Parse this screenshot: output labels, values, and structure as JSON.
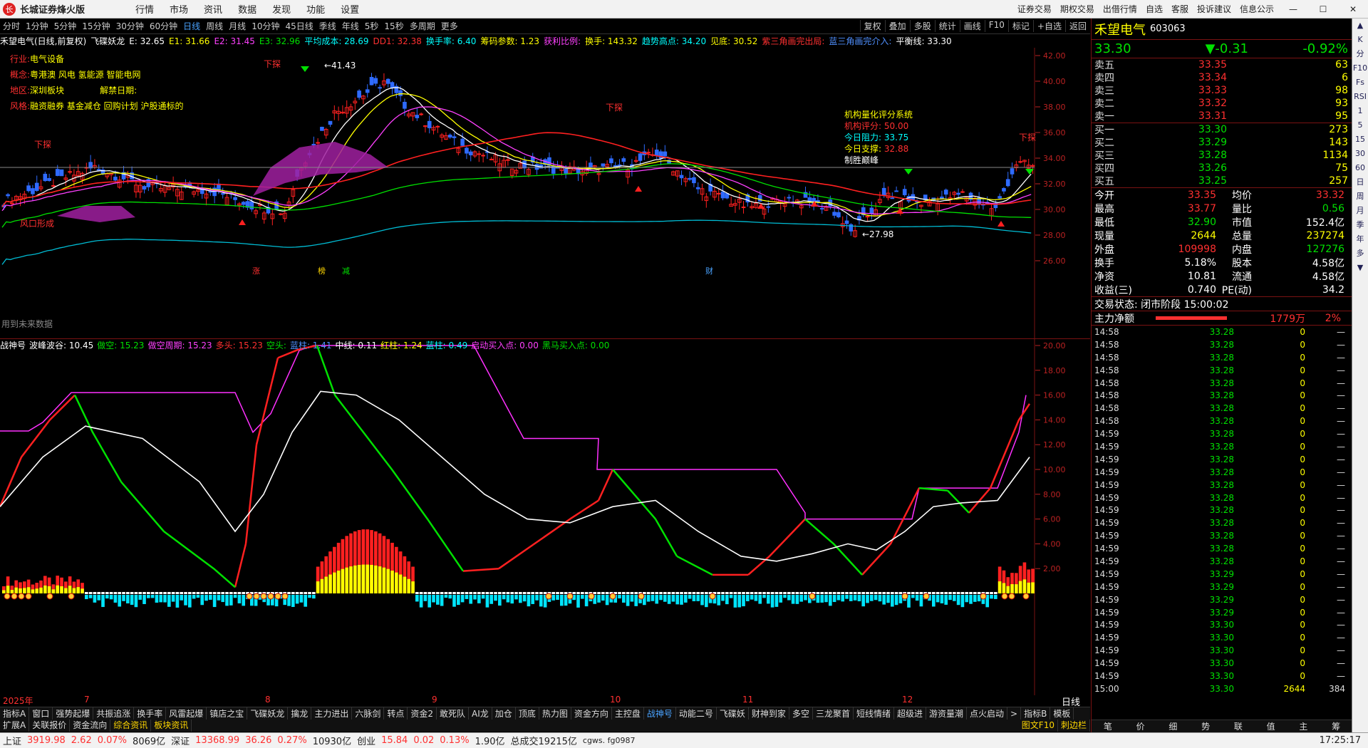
{
  "titlebar": {
    "app_title": "长城证券烽火版",
    "menu": [
      "行情",
      "市场",
      "资讯",
      "数据",
      "发现",
      "功能",
      "设置"
    ],
    "right": [
      "证券交易",
      "期权交易",
      "出借行情",
      "自选",
      "客服",
      "投诉建议",
      "信息公示"
    ]
  },
  "periods": [
    "分时",
    "1分钟",
    "5分钟",
    "15分钟",
    "30分钟",
    "60分钟",
    "日线",
    "周线",
    "月线",
    "10分钟",
    "45日线",
    "季线",
    "年线",
    "5秒",
    "15秒",
    "多周期",
    "更多"
  ],
  "active_period": "日线",
  "right_buttons": [
    "复权",
    "叠加",
    "多股",
    "统计",
    "画线",
    "F10",
    "标记",
    "+自选",
    "返回"
  ],
  "info": [
    {
      "t": "禾望电气(日线,前复权)",
      "c": "white"
    },
    {
      "t": "飞碟妖龙",
      "c": "white"
    },
    {
      "t": "E: 32.65",
      "c": "white"
    },
    {
      "t": "E1: 31.66",
      "c": "yellow"
    },
    {
      "t": "E2: 31.45",
      "c": "magenta"
    },
    {
      "t": "E3: 32.96",
      "c": "green"
    },
    {
      "t": "平均成本: 28.69",
      "c": "cyan"
    },
    {
      "t": "DD1: 32.38",
      "c": "red"
    },
    {
      "t": "换手率: 6.40",
      "c": "cyan"
    },
    {
      "t": "筹码参数: 1.23",
      "c": "yellow"
    },
    {
      "t": "获利比例:",
      "c": "magenta"
    },
    {
      "t": "换手: 143.32",
      "c": "yellow"
    },
    {
      "t": "趋势高点: 34.20",
      "c": "cyan"
    },
    {
      "t": "见底: 30.52",
      "c": "yellow"
    },
    {
      "t": "紫三角画完出局:",
      "c": "red"
    },
    {
      "t": "蓝三角画完介入:",
      "c": "blue"
    },
    {
      "t": "平衡线: 33.30",
      "c": "white"
    }
  ],
  "stock_info": {
    "industry": "行业:",
    "industry_val": "电气设备",
    "concept": "概念:",
    "concept_val": "粤港澳 风电 氢能源 智能电网",
    "region": "地区:",
    "region_val": "深圳板块",
    "unlock": "解禁日期:",
    "style": "风格:",
    "style_val": "融资融券 基金减仓 回购计划 沪股通标的"
  },
  "rating": {
    "title": "机构量化评分系统",
    "score_label": "机构评分:",
    "score": "50.00",
    "resist_label": "今日阻力:",
    "resist": "33.75",
    "support_label": "今日支撑:",
    "support": "32.88",
    "tag": "制胜巅峰"
  },
  "chart_labels": {
    "future": "用到未来数据",
    "xiatan": "下探",
    "fengkou": "风口形成",
    "high": "41.43",
    "low": "27.98",
    "zhangting": "涨",
    "bang": "榜",
    "jian": "减",
    "cai": "财"
  },
  "y_ticks_main": [
    "42.00",
    "40.00",
    "38.00",
    "36.00",
    "34.00",
    "32.00",
    "30.00",
    "28.00",
    "26.00"
  ],
  "sub_info": [
    {
      "t": "战神号",
      "c": "white"
    },
    {
      "t": "波峰波谷: 10.45",
      "c": "white"
    },
    {
      "t": "做空: 15.23",
      "c": "green"
    },
    {
      "t": "做空周期: 15.23",
      "c": "magenta"
    },
    {
      "t": "多头: 15.23",
      "c": "red"
    },
    {
      "t": "空头:",
      "c": "green"
    },
    {
      "t": "蓝柱: 1.41",
      "c": "blue"
    },
    {
      "t": "中线: 0.11",
      "c": "white"
    },
    {
      "t": "红柱: 1.24",
      "c": "yellow"
    },
    {
      "t": "蓝柱: 0.49",
      "c": "cyan"
    },
    {
      "t": "启动买入点: 0.00",
      "c": "magenta"
    },
    {
      "t": "黑马买入点: 0.00",
      "c": "green"
    }
  ],
  "y_ticks_sub": [
    "20.00",
    "18.00",
    "16.00",
    "14.00",
    "12.00",
    "10.00",
    "8.00",
    "6.00",
    "4.00",
    "2.00"
  ],
  "dates": [
    "2025年",
    "7",
    "8",
    "9",
    "10",
    "11",
    "12"
  ],
  "tabs1": [
    "指标A",
    "窗口",
    "强势起爆",
    "共振追涨",
    "换手率",
    "风雷起爆",
    "镇店之宝",
    "飞碟妖龙",
    "擒龙",
    "主力进出",
    "六脉剑",
    "转点",
    "资金2",
    "敢死队",
    "AI龙",
    "加仓",
    "顶底",
    "热力图",
    "资金方向",
    "主控盘",
    "战神号",
    "动能二号",
    "飞碟妖",
    "财神到家",
    "多空",
    "三龙聚首",
    "短线情绪",
    "超级进",
    "游资量潮",
    "点火启动",
    ">",
    "指标B",
    "模板"
  ],
  "tabs1_active": "战神号",
  "tabs2": [
    "扩展A",
    "关联报价",
    "资金流向",
    "综合资讯",
    "板块资讯"
  ],
  "tabs2_right": [
    "图文F10",
    "刺边栏"
  ],
  "status": {
    "sh_label": "上证",
    "sh": "3919.98",
    "sh_chg": "2.62",
    "sh_pct": "0.07%",
    "sh_amt": "8069亿",
    "sz_label": "深证",
    "sz": "13368.99",
    "sz_chg": "36.26",
    "sz_pct": "0.27%",
    "sz_amt": "10930亿",
    "cy_label": "创业",
    "cy": "15.84",
    "cy_chg": "0.02",
    "cy_pct": "0.13%",
    "cy_amt": "1.90亿",
    "total": "总成交19215亿",
    "server": "cgws. fg0987",
    "time": "17:25:17"
  },
  "quote": {
    "name": "禾望电气",
    "code": "603063",
    "price": "33.30",
    "chg": "▼-0.31",
    "pct": "-0.92%",
    "asks": [
      {
        "l": "卖五",
        "p": "33.35",
        "v": "63"
      },
      {
        "l": "卖四",
        "p": "33.34",
        "v": "6"
      },
      {
        "l": "卖三",
        "p": "33.33",
        "v": "98"
      },
      {
        "l": "卖二",
        "p": "33.32",
        "v": "93"
      },
      {
        "l": "卖一",
        "p": "33.31",
        "v": "95"
      }
    ],
    "bids": [
      {
        "l": "买一",
        "p": "33.30",
        "v": "273"
      },
      {
        "l": "买二",
        "p": "33.29",
        "v": "143"
      },
      {
        "l": "买三",
        "p": "33.28",
        "v": "1134"
      },
      {
        "l": "买四",
        "p": "33.26",
        "v": "75"
      },
      {
        "l": "买五",
        "p": "33.25",
        "v": "257"
      }
    ],
    "stats": [
      {
        "a": "今开",
        "b": "33.35",
        "bc": "red",
        "c": "均价",
        "d": "33.32",
        "dc": "red"
      },
      {
        "a": "最高",
        "b": "33.77",
        "bc": "red",
        "c": "量比",
        "d": "0.56",
        "dc": "green"
      },
      {
        "a": "最低",
        "b": "32.90",
        "bc": "green",
        "c": "市值",
        "d": "152.4亿",
        "dc": "white"
      },
      {
        "a": "现量",
        "b": "2644",
        "bc": "yellow",
        "c": "总量",
        "d": "237274",
        "dc": "yellow"
      },
      {
        "a": "外盘",
        "b": "109998",
        "bc": "red",
        "c": "内盘",
        "d": "127276",
        "dc": "green"
      },
      {
        "a": "换手",
        "b": "5.18%",
        "bc": "white",
        "c": "股本",
        "d": "4.58亿",
        "dc": "white"
      },
      {
        "a": "净资",
        "b": "10.81",
        "bc": "white",
        "c": "流通",
        "d": "4.58亿",
        "dc": "white"
      },
      {
        "a": "收益(三)",
        "b": "0.740",
        "bc": "white",
        "c": "PE(动)",
        "d": "34.2",
        "dc": "white"
      }
    ],
    "trade_state": "交易状态: 闭市阶段 15:00:02",
    "main_flow_label": "主力净额",
    "main_flow": "1779万",
    "main_flow_pct": "2%"
  },
  "ticks": [
    {
      "t": "14:58",
      "p": "33.28",
      "v": "0"
    },
    {
      "t": "14:58",
      "p": "33.28",
      "v": "0"
    },
    {
      "t": "14:58",
      "p": "33.28",
      "v": "0"
    },
    {
      "t": "14:58",
      "p": "33.28",
      "v": "0"
    },
    {
      "t": "14:58",
      "p": "33.28",
      "v": "0"
    },
    {
      "t": "14:58",
      "p": "33.28",
      "v": "0"
    },
    {
      "t": "14:58",
      "p": "33.28",
      "v": "0"
    },
    {
      "t": "14:58",
      "p": "33.28",
      "v": "0"
    },
    {
      "t": "14:59",
      "p": "33.28",
      "v": "0"
    },
    {
      "t": "14:59",
      "p": "33.28",
      "v": "0"
    },
    {
      "t": "14:59",
      "p": "33.28",
      "v": "0"
    },
    {
      "t": "14:59",
      "p": "33.28",
      "v": "0"
    },
    {
      "t": "14:59",
      "p": "33.28",
      "v": "0"
    },
    {
      "t": "14:59",
      "p": "33.28",
      "v": "0"
    },
    {
      "t": "14:59",
      "p": "33.28",
      "v": "0"
    },
    {
      "t": "14:59",
      "p": "33.28",
      "v": "0"
    },
    {
      "t": "14:59",
      "p": "33.28",
      "v": "0"
    },
    {
      "t": "14:59",
      "p": "33.28",
      "v": "0"
    },
    {
      "t": "14:59",
      "p": "33.28",
      "v": "0"
    },
    {
      "t": "14:59",
      "p": "33.29",
      "v": "0"
    },
    {
      "t": "14:59",
      "p": "33.29",
      "v": "0"
    },
    {
      "t": "14:59",
      "p": "33.29",
      "v": "0"
    },
    {
      "t": "14:59",
      "p": "33.29",
      "v": "0"
    },
    {
      "t": "14:59",
      "p": "33.30",
      "v": "0"
    },
    {
      "t": "14:59",
      "p": "33.30",
      "v": "0"
    },
    {
      "t": "14:59",
      "p": "33.30",
      "v": "0"
    },
    {
      "t": "14:59",
      "p": "33.30",
      "v": "0"
    },
    {
      "t": "14:59",
      "p": "33.30",
      "v": "0"
    },
    {
      "t": "15:00",
      "p": "33.30",
      "v": "2644",
      "d": "384"
    }
  ],
  "bottom_tabs": [
    "笔",
    "价",
    "细",
    "势",
    "联",
    "值",
    "主",
    "筹"
  ],
  "toolbar": [
    "K",
    "分",
    "F10",
    "Fs",
    "RSI",
    "1",
    "5",
    "15",
    "30",
    "60",
    "日",
    "周",
    "月",
    "季",
    "年",
    "多"
  ]
}
